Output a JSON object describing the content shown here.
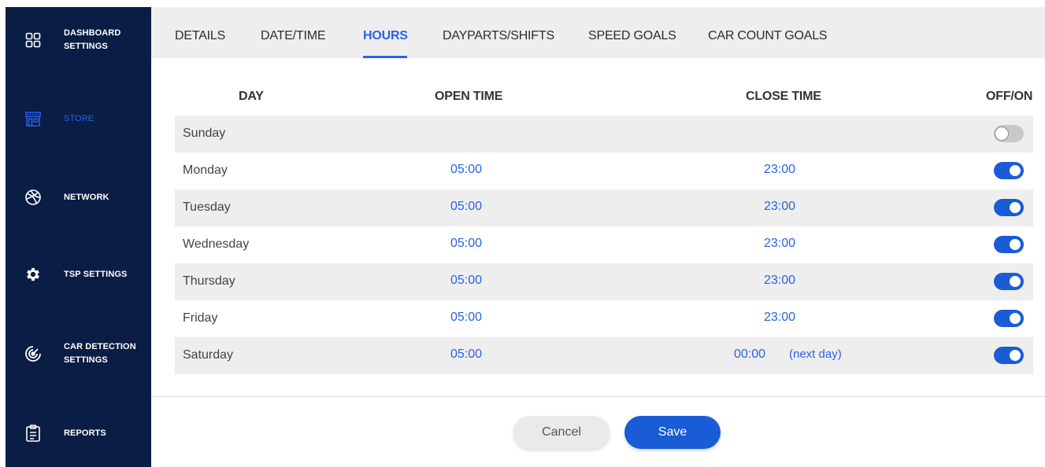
{
  "sidebar": {
    "items": [
      {
        "label_line1": "DASHBOARD",
        "label_line2": "SETTINGS",
        "icon": "dashboard-grid-icon"
      },
      {
        "label_line1": "STORE",
        "label_line2": "",
        "icon": "store-icon",
        "active": true
      },
      {
        "label_line1": "NETWORK",
        "label_line2": "",
        "icon": "network-icon"
      },
      {
        "label_line1": "TSP SETTINGS",
        "label_line2": "",
        "icon": "gear-icon"
      },
      {
        "label_line1": "CAR DETECTION",
        "label_line2": "SETTINGS",
        "icon": "car-detection-icon"
      },
      {
        "label_line1": "REPORTS",
        "label_line2": "",
        "icon": "clipboard-icon"
      }
    ]
  },
  "tabs": [
    {
      "label": "DETAILS"
    },
    {
      "label": "DATE/TIME"
    },
    {
      "label": "HOURS",
      "active": true
    },
    {
      "label": "DAYPARTS/SHIFTS"
    },
    {
      "label": "SPEED GOALS"
    },
    {
      "label": "CAR COUNT GOALS"
    }
  ],
  "table": {
    "headers": {
      "day": "DAY",
      "open": "OPEN TIME",
      "close": "CLOSE TIME",
      "toggle": "OFF/ON"
    },
    "rows": [
      {
        "day": "Sunday",
        "open": "",
        "close": "",
        "close_note": "",
        "on": false
      },
      {
        "day": "Monday",
        "open": "05:00",
        "close": "23:00",
        "close_note": "",
        "on": true
      },
      {
        "day": "Tuesday",
        "open": "05:00",
        "close": "23:00",
        "close_note": "",
        "on": true
      },
      {
        "day": "Wednesday",
        "open": "05:00",
        "close": "23:00",
        "close_note": "",
        "on": true
      },
      {
        "day": "Thursday",
        "open": "05:00",
        "close": "23:00",
        "close_note": "",
        "on": true
      },
      {
        "day": "Friday",
        "open": "05:00",
        "close": "23:00",
        "close_note": "",
        "on": true
      },
      {
        "day": "Saturday",
        "open": "05:00",
        "close": "00:00",
        "close_note": "(next day)",
        "on": true
      }
    ]
  },
  "actions": {
    "cancel_label": "Cancel",
    "save_label": "Save"
  },
  "colors": {
    "sidebar_bg": "#0a1d44",
    "accent": "#2a62e6",
    "toggle_on": "#1a5cd6",
    "toggle_off": "#c9c9c9",
    "row_shade": "#eeeeee"
  }
}
